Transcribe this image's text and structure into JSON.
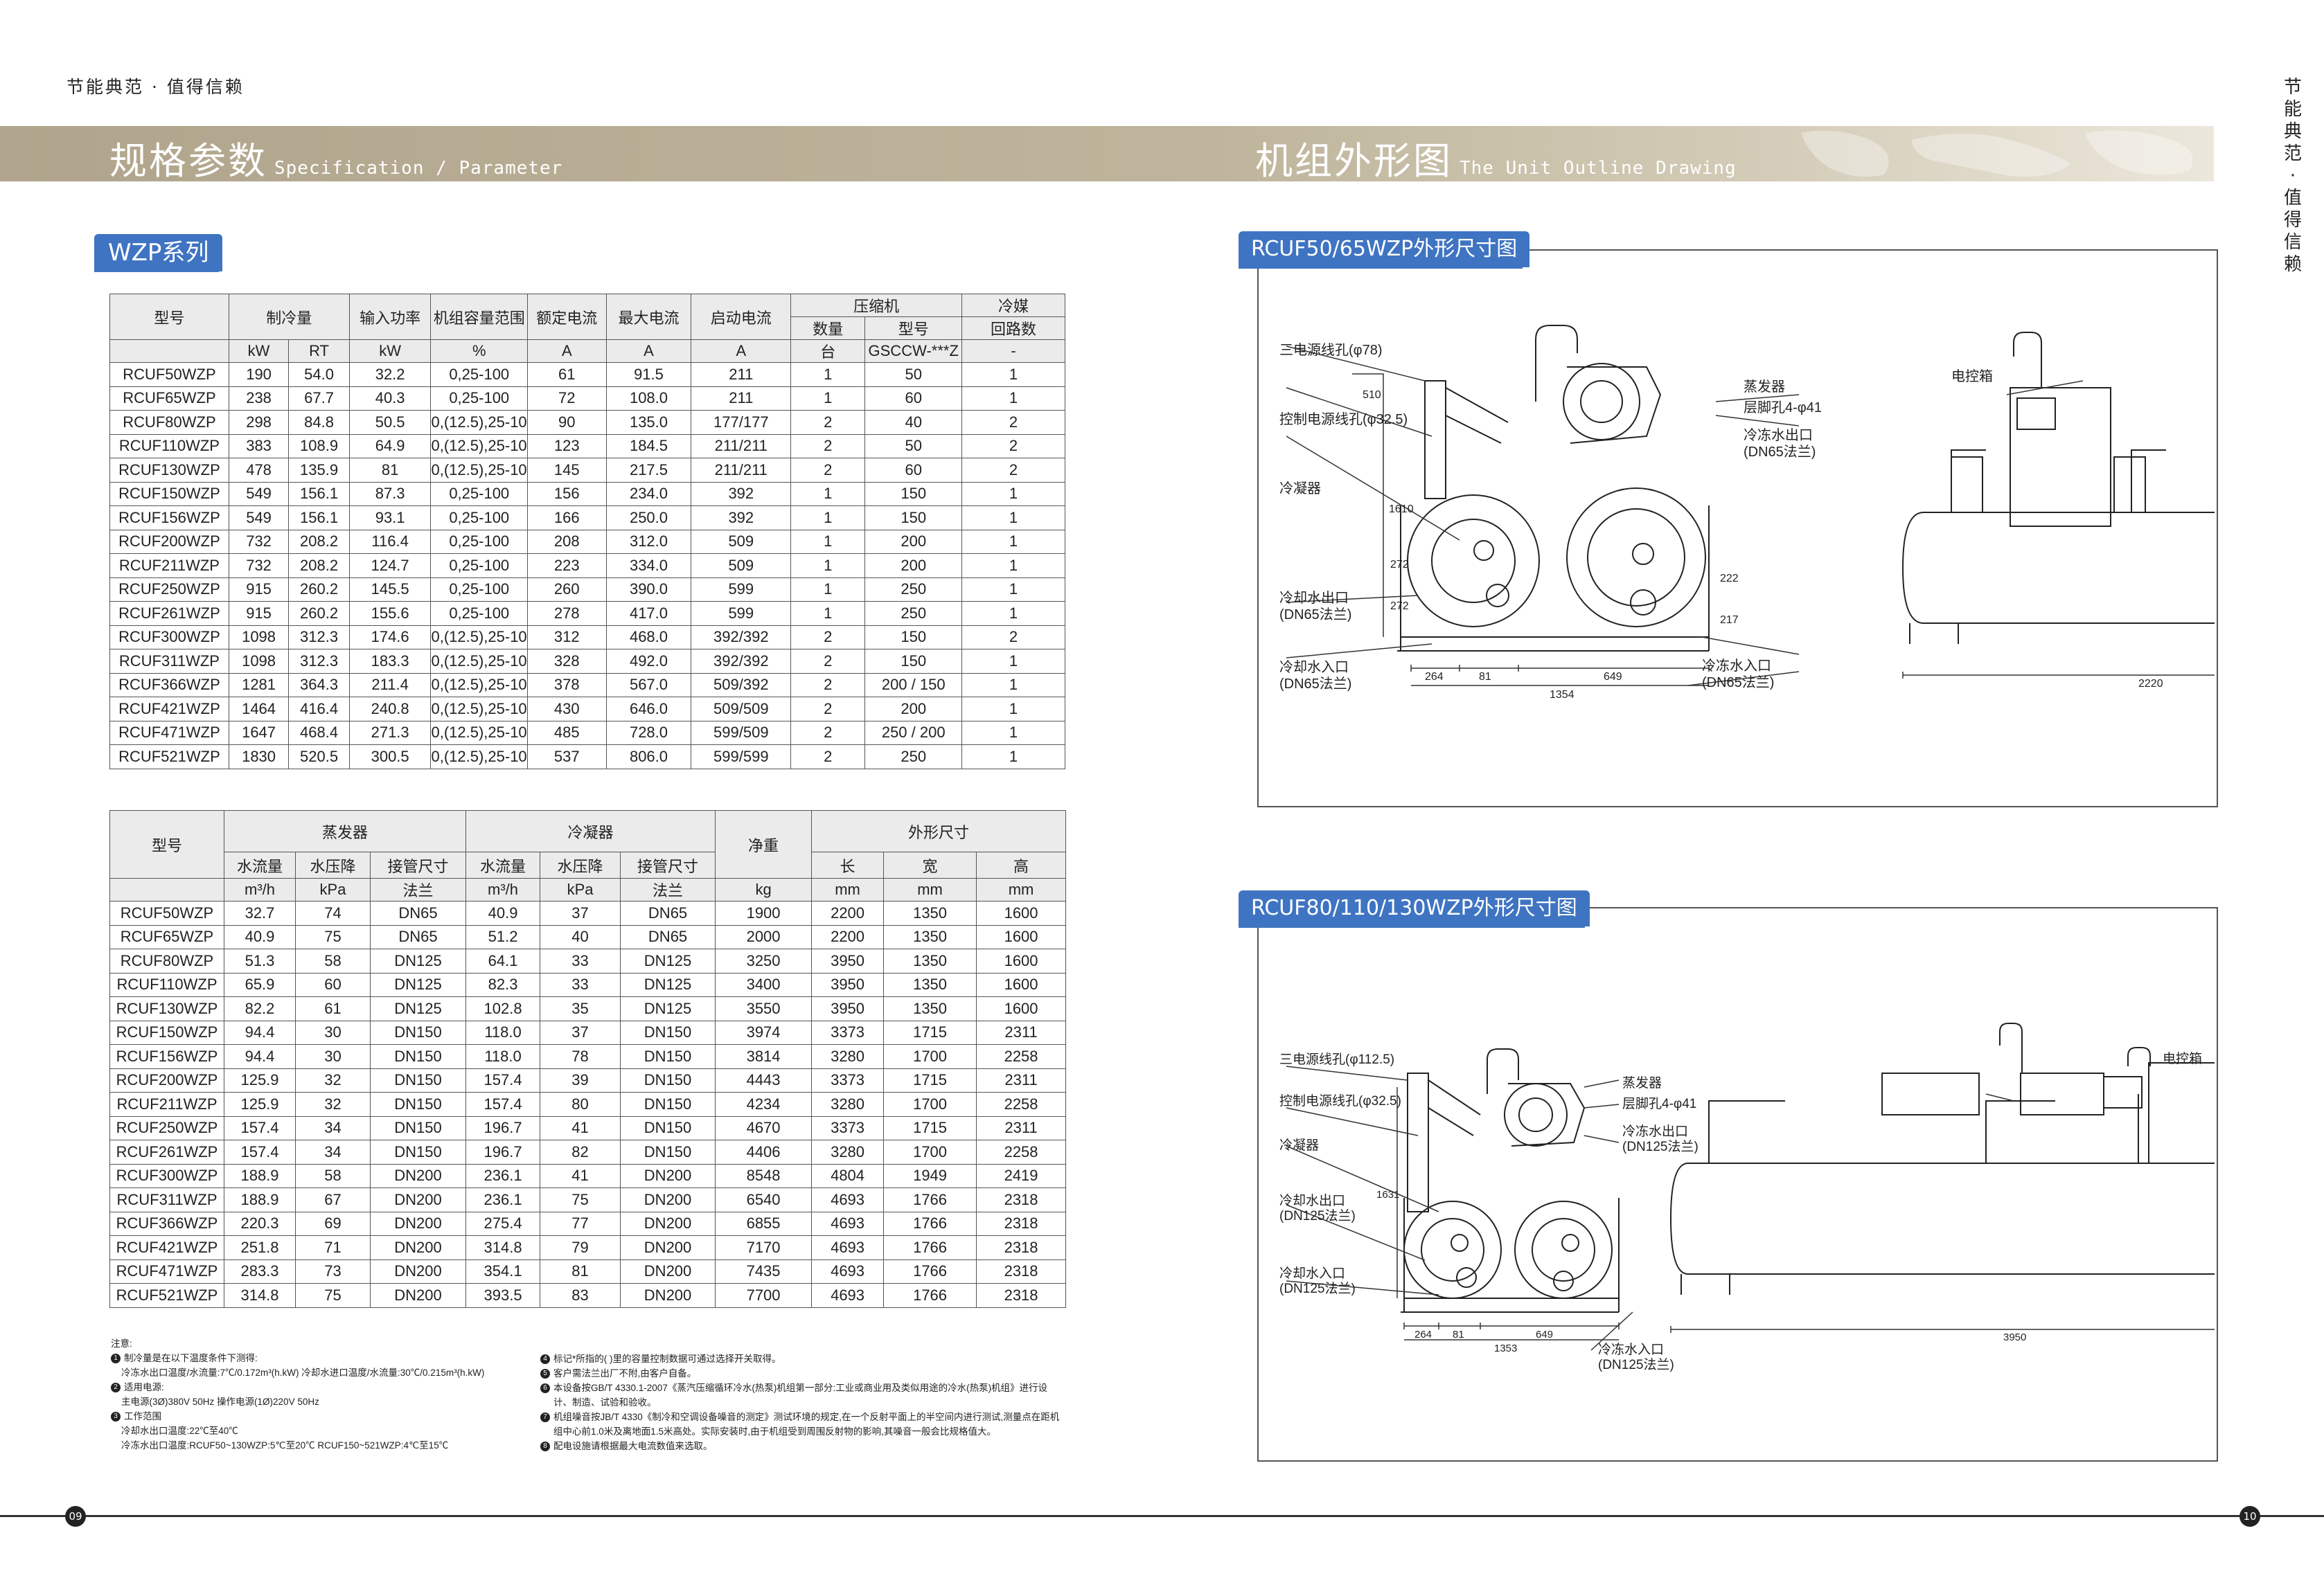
{
  "header": {
    "tagline": "节能典范 · 值得信赖",
    "vertical_tagline": [
      "节",
      "能",
      "典",
      "范",
      "·",
      "值",
      "得",
      "信",
      "赖"
    ],
    "left_title_cn": "规格参数",
    "left_title_en": "Specification / Parameter",
    "right_title_cn": "机组外形图",
    "right_title_en": "The Unit Outline Drawing"
  },
  "series_tab": "WZP系列",
  "table1": {
    "headers": {
      "model": "型号",
      "cooling": "制冷量",
      "input_power": "输入功率",
      "capacity_range": "机组容量范围",
      "rated_current": "额定电流",
      "max_current": "最大电流",
      "start_current": "启动电流",
      "compressor": "压缩机",
      "comp_qty": "数量",
      "comp_model": "型号",
      "refrigerant": "冷媒",
      "circuits": "回路数"
    },
    "units": [
      "kW",
      "RT",
      "kW",
      "%",
      "A",
      "A",
      "A",
      "台",
      "GSCCW-***Z",
      "-"
    ],
    "rows": [
      [
        "RCUF50WZP",
        "190",
        "54.0",
        "32.2",
        "0,25-100",
        "61",
        "91.5",
        "211",
        "1",
        "50",
        "1"
      ],
      [
        "RCUF65WZP",
        "238",
        "67.7",
        "40.3",
        "0,25-100",
        "72",
        "108.0",
        "211",
        "1",
        "60",
        "1"
      ],
      [
        "RCUF80WZP",
        "298",
        "84.8",
        "50.5",
        "0,(12.5),25-100",
        "90",
        "135.0",
        "177/177",
        "2",
        "40",
        "2"
      ],
      [
        "RCUF110WZP",
        "383",
        "108.9",
        "64.9",
        "0,(12.5),25-100",
        "123",
        "184.5",
        "211/211",
        "2",
        "50",
        "2"
      ],
      [
        "RCUF130WZP",
        "478",
        "135.9",
        "81",
        "0,(12.5),25-100",
        "145",
        "217.5",
        "211/211",
        "2",
        "60",
        "2"
      ],
      [
        "RCUF150WZP",
        "549",
        "156.1",
        "87.3",
        "0,25-100",
        "156",
        "234.0",
        "392",
        "1",
        "150",
        "1"
      ],
      [
        "RCUF156WZP",
        "549",
        "156.1",
        "93.1",
        "0,25-100",
        "166",
        "250.0",
        "392",
        "1",
        "150",
        "1"
      ],
      [
        "RCUF200WZP",
        "732",
        "208.2",
        "116.4",
        "0,25-100",
        "208",
        "312.0",
        "509",
        "1",
        "200",
        "1"
      ],
      [
        "RCUF211WZP",
        "732",
        "208.2",
        "124.7",
        "0,25-100",
        "223",
        "334.0",
        "509",
        "1",
        "200",
        "1"
      ],
      [
        "RCUF250WZP",
        "915",
        "260.2",
        "145.5",
        "0,25-100",
        "260",
        "390.0",
        "599",
        "1",
        "250",
        "1"
      ],
      [
        "RCUF261WZP",
        "915",
        "260.2",
        "155.6",
        "0,25-100",
        "278",
        "417.0",
        "599",
        "1",
        "250",
        "1"
      ],
      [
        "RCUF300WZP",
        "1098",
        "312.3",
        "174.6",
        "0,(12.5),25-100",
        "312",
        "468.0",
        "392/392",
        "2",
        "150",
        "2"
      ],
      [
        "RCUF311WZP",
        "1098",
        "312.3",
        "183.3",
        "0,(12.5),25-100",
        "328",
        "492.0",
        "392/392",
        "2",
        "150",
        "1"
      ],
      [
        "RCUF366WZP",
        "1281",
        "364.3",
        "211.4",
        "0,(12.5),25-100",
        "378",
        "567.0",
        "509/392",
        "2",
        "200 / 150",
        "1"
      ],
      [
        "RCUF421WZP",
        "1464",
        "416.4",
        "240.8",
        "0,(12.5),25-100",
        "430",
        "646.0",
        "509/509",
        "2",
        "200",
        "1"
      ],
      [
        "RCUF471WZP",
        "1647",
        "468.4",
        "271.3",
        "0,(12.5),25-100",
        "485",
        "728.0",
        "599/509",
        "2",
        "250 / 200",
        "1"
      ],
      [
        "RCUF521WZP",
        "1830",
        "520.5",
        "300.5",
        "0,(12.5),25-100",
        "537",
        "806.0",
        "599/599",
        "2",
        "250",
        "1"
      ]
    ]
  },
  "table2": {
    "headers": {
      "model": "型号",
      "evaporator": "蒸发器",
      "condenser": "冷凝器",
      "net_weight": "净重",
      "dimensions": "外形尺寸",
      "flow": "水流量",
      "pressure_drop": "水压降",
      "pipe_size": "接管尺寸",
      "length": "长",
      "width": "宽",
      "height": "高"
    },
    "units": [
      "m³/h",
      "kPa",
      "法兰",
      "m³/h",
      "kPa",
      "法兰",
      "kg",
      "mm",
      "mm",
      "mm"
    ],
    "rows": [
      [
        "RCUF50WZP",
        "32.7",
        "74",
        "DN65",
        "40.9",
        "37",
        "DN65",
        "1900",
        "2200",
        "1350",
        "1600"
      ],
      [
        "RCUF65WZP",
        "40.9",
        "75",
        "DN65",
        "51.2",
        "40",
        "DN65",
        "2000",
        "2200",
        "1350",
        "1600"
      ],
      [
        "RCUF80WZP",
        "51.3",
        "58",
        "DN125",
        "64.1",
        "33",
        "DN125",
        "3250",
        "3950",
        "1350",
        "1600"
      ],
      [
        "RCUF110WZP",
        "65.9",
        "60",
        "DN125",
        "82.3",
        "33",
        "DN125",
        "3400",
        "3950",
        "1350",
        "1600"
      ],
      [
        "RCUF130WZP",
        "82.2",
        "61",
        "DN125",
        "102.8",
        "35",
        "DN125",
        "3550",
        "3950",
        "1350",
        "1600"
      ],
      [
        "RCUF150WZP",
        "94.4",
        "30",
        "DN150",
        "118.0",
        "37",
        "DN150",
        "3974",
        "3373",
        "1715",
        "2311"
      ],
      [
        "RCUF156WZP",
        "94.4",
        "30",
        "DN150",
        "118.0",
        "78",
        "DN150",
        "3814",
        "3280",
        "1700",
        "2258"
      ],
      [
        "RCUF200WZP",
        "125.9",
        "32",
        "DN150",
        "157.4",
        "39",
        "DN150",
        "4443",
        "3373",
        "1715",
        "2311"
      ],
      [
        "RCUF211WZP",
        "125.9",
        "32",
        "DN150",
        "157.4",
        "80",
        "DN150",
        "4234",
        "3280",
        "1700",
        "2258"
      ],
      [
        "RCUF250WZP",
        "157.4",
        "34",
        "DN150",
        "196.7",
        "41",
        "DN150",
        "4670",
        "3373",
        "1715",
        "2311"
      ],
      [
        "RCUF261WZP",
        "157.4",
        "34",
        "DN150",
        "196.7",
        "82",
        "DN150",
        "4406",
        "3280",
        "1700",
        "2258"
      ],
      [
        "RCUF300WZP",
        "188.9",
        "58",
        "DN200",
        "236.1",
        "41",
        "DN200",
        "8548",
        "4804",
        "1949",
        "2419"
      ],
      [
        "RCUF311WZP",
        "188.9",
        "67",
        "DN200",
        "236.1",
        "75",
        "DN200",
        "6540",
        "4693",
        "1766",
        "2318"
      ],
      [
        "RCUF366WZP",
        "220.3",
        "69",
        "DN200",
        "275.4",
        "77",
        "DN200",
        "6855",
        "4693",
        "1766",
        "2318"
      ],
      [
        "RCUF421WZP",
        "251.8",
        "71",
        "DN200",
        "314.8",
        "79",
        "DN200",
        "7170",
        "4693",
        "1766",
        "2318"
      ],
      [
        "RCUF471WZP",
        "283.3",
        "73",
        "DN200",
        "354.1",
        "81",
        "DN200",
        "7435",
        "4693",
        "1766",
        "2318"
      ],
      [
        "RCUF521WZP",
        "314.8",
        "75",
        "DN200",
        "393.5",
        "83",
        "DN200",
        "7700",
        "4693",
        "1766",
        "2318"
      ]
    ]
  },
  "notes": {
    "title": "注意:",
    "n1": "制冷量是在以下温度条件下测得:",
    "n1a": "冷冻水出口温度/水流量:7℃/0.172m³(h.kW)      冷却水进口温度/水流量:30℃/0.215m³(h.kW)",
    "n2": "适用电源:",
    "n2a": "主电源(3Ø)380V 50Hz    操作电源(1Ø)220V 50Hz",
    "n3": "工作范围",
    "n3a": "冷却水出口温度:22℃至40℃",
    "n3b": "冷冻水出口温度:RCUF50~130WZP:5℃至20℃     RCUF150~521WZP:4℃至15℃",
    "n4": "标记*所指的( )里的容量控制数据可通过选择开关取得。",
    "n5": "客户需法兰出厂不附,由客户自备。",
    "n6": "本设备按GB/T  4330.1-2007《蒸汽压缩循环冷水(热泵)机组第一部分:工业或商业用及类似用途的冷水(热泵)机组》进行设",
    "n6a": "计、制造、试验和验收。",
    "n7": "机组噪音按JB/T 4330《制冷和空调设备噪音的测定》测试环境的规定,在一个反射平面上的半空间内进行测试,测量点在距机",
    "n7a": "组中心前1.0米及离地面1.5米高处。实际安装时,由于机组受到周围反射物的影响,其噪音一般会比规格值大。",
    "n8": "配电设施请根据最大电流数值来选取。"
  },
  "drawings": {
    "d1_title": "RCUF50/65WZP外形尺寸图",
    "d2_title": "RCUF80/110/130WZP外形尺寸图",
    "d1": {
      "l_power_hole": "三电源线孔(φ78)",
      "l_ctrl_hole": "控制电源线孔(φ32.5)",
      "l_condenser": "冷凝器",
      "l_evaporator": "蒸发器",
      "l_foot_hole": "层脚孔4-φ41",
      "l_chw_out": "冷冻水出口",
      "l_chw_out_dn": "(DN65法兰)",
      "l_cw_out": "冷却水出口",
      "l_cw_out_dn": "(DN65法兰)",
      "l_cw_in": "冷却水入口",
      "l_cw_in_dn": "(DN65法兰)",
      "l_chw_in": "冷冻水入口",
      "l_chw_in_dn": "(DN65法兰)",
      "l_control_box": "电控箱",
      "dim_264": "264",
      "dim_81": "81",
      "dim_649": "649",
      "dim_1354": "1354",
      "dim_2220": "2220",
      "dim_272a": "272",
      "dim_272b": "272",
      "dim_222": "222",
      "dim_217": "217",
      "dim_1610": "1610",
      "dim_510": "510"
    },
    "d2": {
      "l_power_hole": "三电源线孔(φ112.5)",
      "l_ctrl_hole": "控制电源线孔(φ32.5)",
      "l_condenser": "冷凝器",
      "l_evaporator": "蒸发器",
      "l_foot_hole": "层脚孔4-φ41",
      "l_chw_out": "冷冻水出口",
      "l_chw_out_dn": "(DN125法兰)",
      "l_cw_out": "冷却水出口",
      "l_cw_out_dn": "(DN125法兰)",
      "l_cw_in": "冷却水入口",
      "l_cw_in_dn": "(DN125法兰)",
      "l_chw_in": "冷冻水入口",
      "l_chw_in_dn": "(DN125法兰)",
      "l_control_box": "电控箱",
      "dim_264": "264",
      "dim_81": "81",
      "dim_649": "649",
      "dim_1353": "1353",
      "dim_3950": "3950",
      "dim_1631": "1631"
    }
  },
  "footer": {
    "page_left": "09",
    "page_right": "10"
  }
}
